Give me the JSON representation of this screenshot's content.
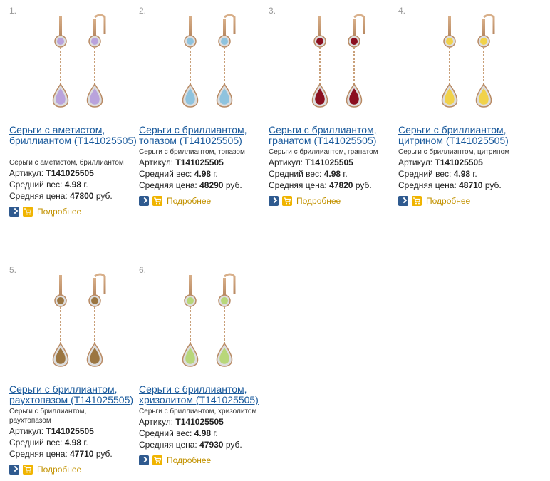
{
  "products": [
    {
      "num": "1.",
      "title": "Серьги с аметистом, бриллиантом (Т141025505)",
      "desc": "Серьги с аметистом, бриллиантом",
      "article_label": "Артикул:",
      "article": "Т141025505",
      "weight_label": "Средний вес:",
      "weight": "4.98",
      "weight_unit": "г.",
      "price_label": "Средняя цена:",
      "price": "47800",
      "currency": "руб.",
      "more": "Подробнее",
      "gem_color": "#b9a3dc"
    },
    {
      "num": "2.",
      "title": "Серьги с бриллиантом, топазом (Т141025505)",
      "desc": "Серьги с бриллиантом, топазом",
      "article_label": "Артикул:",
      "article": "Т141025505",
      "weight_label": "Средний вес:",
      "weight": "4.98",
      "weight_unit": "г.",
      "price_label": "Средняя цена:",
      "price": "48290",
      "currency": "руб.",
      "more": "Подробнее",
      "gem_color": "#8fc3de"
    },
    {
      "num": "3.",
      "title": "Серьги с бриллиантом, гранатом (Т141025505)",
      "desc": "Серьги с бриллиантом, гранатом",
      "article_label": "Артикул:",
      "article": "Т141025505",
      "weight_label": "Средний вес:",
      "weight": "4.98",
      "weight_unit": "г.",
      "price_label": "Средняя цена:",
      "price": "47820",
      "currency": "руб.",
      "more": "Подробнее",
      "gem_color": "#8b1020"
    },
    {
      "num": "4.",
      "title": "Серьги с бриллиантом, цитрином (Т141025505)",
      "desc": "Серьги с бриллиантом, цитрином",
      "article_label": "Артикул:",
      "article": "Т141025505",
      "weight_label": "Средний вес:",
      "weight": "4.98",
      "weight_unit": "г.",
      "price_label": "Средняя цена:",
      "price": "48710",
      "currency": "руб.",
      "more": "Подробнее",
      "gem_color": "#f1d24a"
    },
    {
      "num": "5.",
      "title": "Серьги с бриллиантом, раухтопазом (Т141025505)",
      "desc": "Серьги с бриллиантом, раухтопазом",
      "article_label": "Артикул:",
      "article": "Т141025505",
      "weight_label": "Средний вес:",
      "weight": "4.98",
      "weight_unit": "г.",
      "price_label": "Средняя цена:",
      "price": "47710",
      "currency": "руб.",
      "more": "Подробнее",
      "gem_color": "#9b7642"
    },
    {
      "num": "6.",
      "title": "Серьги с бриллиантом, хризолитом (Т141025505)",
      "desc": "Серьги с бриллиантом, хризолитом",
      "article_label": "Артикул:",
      "article": "Т141025505",
      "weight_label": "Средний вес:",
      "weight": "4.98",
      "weight_unit": "г.",
      "price_label": "Средняя цена:",
      "price": "47930",
      "currency": "руб.",
      "more": "Подробнее",
      "gem_color": "#b8d77a"
    }
  ]
}
